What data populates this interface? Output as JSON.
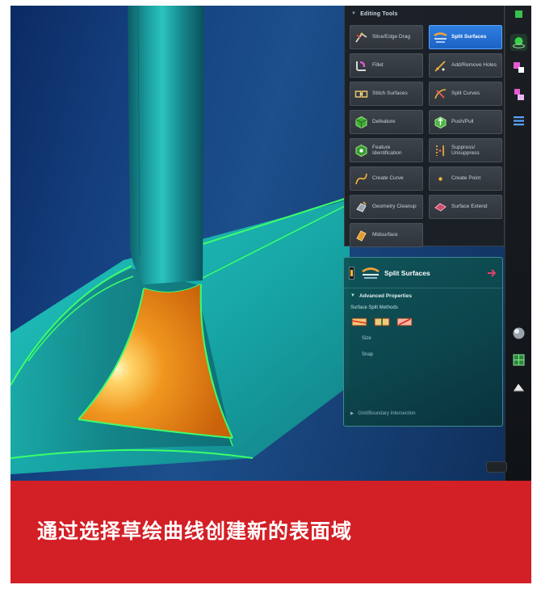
{
  "tools_panel": {
    "header": "Editing Tools",
    "tools": [
      {
        "label": "Slice/Edge Drag",
        "icon": "slice-edge-drag-icon"
      },
      {
        "label": "Split Surfaces",
        "icon": "split-surfaces-icon",
        "active": true
      },
      {
        "label": "Fillet",
        "icon": "fillet-icon"
      },
      {
        "label": "Add/Remove Holes",
        "icon": "add-remove-holes-icon"
      },
      {
        "label": "Stitch Surfaces",
        "icon": "stitch-surfaces-icon"
      },
      {
        "label": "Split Curves",
        "icon": "split-curves-icon"
      },
      {
        "label": "Defeature",
        "icon": "defeature-icon"
      },
      {
        "label": "Push/Pull",
        "icon": "push-pull-icon"
      },
      {
        "label": "Feature Identification",
        "icon": "feature-identification-icon"
      },
      {
        "label": "Suppress/ Unsuppress",
        "icon": "suppress-unsuppress-icon"
      },
      {
        "label": "Create Curve",
        "icon": "create-curve-icon"
      },
      {
        "label": "Create Point",
        "icon": "create-point-icon"
      },
      {
        "label": "Geometry Cleanup",
        "icon": "geometry-cleanup-icon"
      },
      {
        "label": "Surface Extend",
        "icon": "surface-extend-icon"
      },
      {
        "label": "Midsurface",
        "icon": "midsurface-icon"
      }
    ]
  },
  "split_panel": {
    "title": "Split Surfaces",
    "section": "Advanced Properties",
    "methods_label": "Surface Split Methods",
    "prop_rows": [
      "Size",
      "Snap"
    ],
    "footer": "Grid/Boundary Intersection"
  },
  "caption": "通过选择草绘曲线创建新的表面域",
  "colors": {
    "banner": "#d31f26",
    "accent": "#1d63c6",
    "highlight_edges": "#3dff6a",
    "surface_teal": "#1fb3ad",
    "selected_face": "#e07a12"
  }
}
